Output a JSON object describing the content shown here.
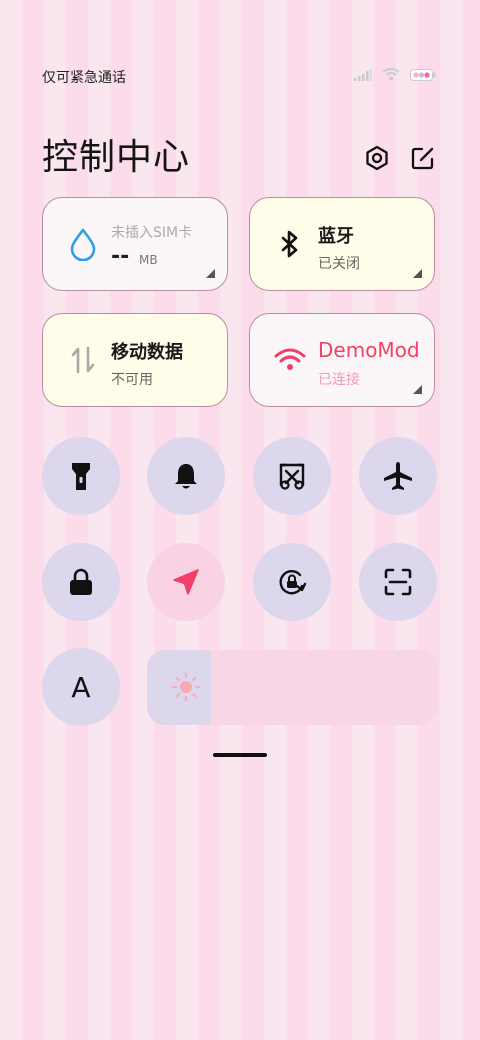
{
  "status_bar": {
    "carrier_text": "仅可紧急通话"
  },
  "header": {
    "title": "控制中心"
  },
  "tiles": {
    "data_usage": {
      "value": "--",
      "unit": "MB",
      "label": "未插入SIM卡"
    },
    "bluetooth": {
      "title": "蓝牙",
      "status": "已关闭"
    },
    "mobile_data": {
      "title": "移动数据",
      "status": "不可用"
    },
    "wifi": {
      "title": "DemoMod",
      "status": "已连接"
    }
  },
  "toggles": [
    {
      "icon": "flashlight-icon",
      "state": "off"
    },
    {
      "icon": "bell-icon",
      "state": "off"
    },
    {
      "icon": "screenshot-icon",
      "state": "off"
    },
    {
      "icon": "airplane-icon",
      "state": "off"
    },
    {
      "icon": "lock-icon",
      "state": "off"
    },
    {
      "icon": "location-icon",
      "state": "on"
    },
    {
      "icon": "rotation-lock-icon",
      "state": "off"
    },
    {
      "icon": "scan-icon",
      "state": "off"
    },
    {
      "icon": "font-icon",
      "state": "off",
      "label": "A"
    }
  ],
  "brightness": {
    "level": 0.22
  },
  "colors": {
    "accent": "#f0406a",
    "toggle_off_bg": "#dcd7ec",
    "toggle_on_bg": "#f9d2e3",
    "tile_white": "#fbf6f7",
    "tile_yellow": "#fffde9"
  }
}
